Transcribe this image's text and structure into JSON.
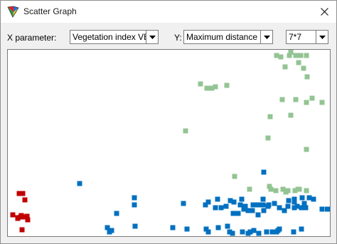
{
  "window": {
    "title": "Scatter Graph"
  },
  "toolbar": {
    "x_label": "X parameter:",
    "x_value": "Vegetation index VE",
    "y_label": "Y:",
    "y_value": "Maximum distance",
    "size_value": "7*7"
  },
  "icons": {
    "app": "tri-color-app-icon",
    "close": "close-icon",
    "dropdown": "chevron-down-icon"
  },
  "colors": {
    "red": "#c00000",
    "blue": "#0070c0",
    "green": "#93c493"
  },
  "chart_data": {
    "type": "scatter",
    "title": "",
    "xlabel": "",
    "ylabel": "",
    "xlim": [
      0,
      453
    ],
    "ylim": [
      0,
      262
    ],
    "grid": false,
    "series": [
      {
        "color": "#c00000",
        "points": [
          [
            16,
            60
          ],
          [
            21,
            60
          ],
          [
            24,
            51
          ],
          [
            14,
            26
          ],
          [
            18,
            27
          ],
          [
            14,
            25
          ],
          [
            7,
            30
          ],
          [
            21,
            27
          ],
          [
            19,
            29
          ],
          [
            28,
            23
          ],
          [
            20,
            9
          ],
          [
            27,
            28
          ]
        ]
      },
      {
        "color": "#0070c0",
        "points": [
          [
            360,
            90
          ],
          [
            101,
            74
          ],
          [
            178,
            54
          ],
          [
            282,
            48
          ],
          [
            295,
            52
          ],
          [
            313,
            50
          ],
          [
            329,
            52
          ],
          [
            359,
            52
          ],
          [
            375,
            46
          ],
          [
            395,
            50
          ],
          [
            403,
            48
          ],
          [
            403,
            52
          ],
          [
            414,
            54
          ],
          [
            424,
            54
          ],
          [
            430,
            52
          ],
          [
            419,
            40
          ],
          [
            178,
            44
          ],
          [
            247,
            46
          ],
          [
            278,
            44
          ],
          [
            292,
            40
          ],
          [
            300,
            40
          ],
          [
            307,
            42
          ],
          [
            318,
            48
          ],
          [
            327,
            44
          ],
          [
            334,
            42
          ],
          [
            345,
            44
          ],
          [
            352,
            44
          ],
          [
            359,
            44
          ],
          [
            366,
            42
          ],
          [
            394,
            42
          ],
          [
            403,
            40
          ],
          [
            407,
            42
          ],
          [
            413,
            40
          ],
          [
            417,
            46
          ],
          [
            452,
            38
          ],
          [
            442,
            38
          ],
          [
            389,
            36
          ],
          [
            317,
            32
          ],
          [
            324,
            32
          ],
          [
            332,
            38
          ],
          [
            338,
            36
          ],
          [
            344,
            36
          ],
          [
            352,
            30
          ],
          [
            360,
            36
          ],
          [
            367,
            44
          ],
          [
            382,
            40
          ],
          [
            153,
            32
          ],
          [
            140,
            12
          ],
          [
            179,
            14
          ],
          [
            232,
            12
          ],
          [
            252,
            10
          ],
          [
            279,
            10
          ],
          [
            282,
            6
          ],
          [
            296,
            12
          ],
          [
            309,
            14
          ],
          [
            312,
            6
          ],
          [
            341,
            6
          ],
          [
            346,
            8
          ],
          [
            353,
            4
          ],
          [
            364,
            6
          ],
          [
            382,
            10
          ],
          [
            378,
            6
          ],
          [
            402,
            6
          ],
          [
            413,
            10
          ],
          [
            143,
            6
          ],
          [
            316,
            4
          ],
          [
            330,
            6
          ],
          [
            338,
            4
          ],
          [
            372,
            6
          ],
          [
            380,
            8
          ],
          [
            146,
            8
          ]
        ]
      },
      {
        "color": "#93c493",
        "points": [
          [
            398,
            260
          ],
          [
            378,
            254
          ],
          [
            384,
            252
          ],
          [
            396,
            254
          ],
          [
            405,
            254
          ],
          [
            412,
            254
          ],
          [
            420,
            254
          ],
          [
            409,
            244
          ],
          [
            390,
            238
          ],
          [
            416,
            236
          ],
          [
            421,
            224
          ],
          [
            386,
            192
          ],
          [
            405,
            192
          ],
          [
            420,
            188
          ],
          [
            428,
            194
          ],
          [
            442,
            188
          ],
          [
            369,
            168
          ],
          [
            398,
            170
          ],
          [
            366,
            138
          ],
          [
            368,
            70
          ],
          [
            420,
            122
          ],
          [
            250,
            148
          ],
          [
            271,
            214
          ],
          [
            280,
            208
          ],
          [
            287,
            208
          ],
          [
            292,
            210
          ],
          [
            308,
            212
          ],
          [
            319,
            84
          ],
          [
            340,
            66
          ],
          [
            370,
            66
          ],
          [
            377,
            64
          ],
          [
            387,
            66
          ],
          [
            394,
            64
          ],
          [
            404,
            64
          ],
          [
            410,
            66
          ],
          [
            420,
            64
          ],
          [
            391,
            62
          ],
          [
            408,
            66
          ]
        ]
      }
    ]
  }
}
